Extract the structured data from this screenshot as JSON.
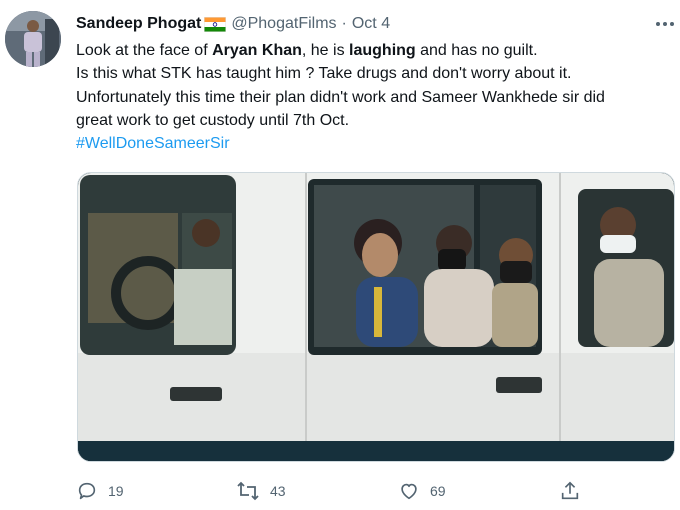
{
  "tweet": {
    "author_name": "Sandeep Phogat",
    "handle": "@PhogatFilms",
    "separator": "·",
    "date": "Oct 4",
    "text": {
      "line1_a": "Look at the face of ",
      "line1_b": "Aryan Khan",
      "line1_c": ", he is ",
      "line1_d": "laughing",
      "line1_e": " and has no guilt.",
      "line2": "Is this what STK has taught him ? Take drugs and don't worry about it.",
      "line3": "Unfortunately this time their plan didn't work and Sameer Wankhede sir did",
      "line4": "great work to get custody until 7th Oct.",
      "hashtag": "#WellDoneSameerSir"
    },
    "actions": {
      "reply_count": "19",
      "retweet_count": "43",
      "like_count": "69"
    },
    "icons": {
      "more": "more-horizontal-icon",
      "reply": "reply-icon",
      "retweet": "retweet-icon",
      "like": "heart-icon",
      "share": "share-icon",
      "flag": "india-flag-icon"
    },
    "colors": {
      "text": "#0f1419",
      "secondary": "#536471",
      "accent": "#1d9bf0"
    }
  }
}
